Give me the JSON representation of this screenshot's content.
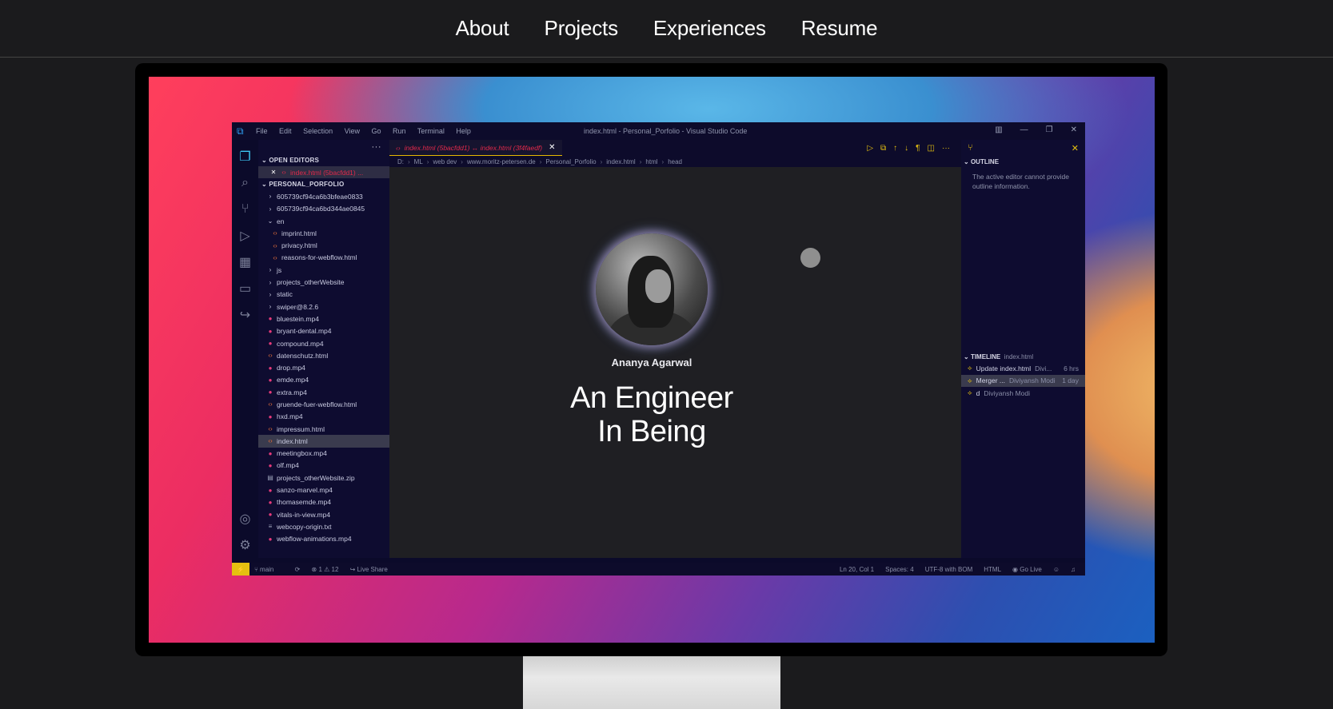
{
  "nav": {
    "items": [
      "About",
      "Projects",
      "Experiences",
      "Resume"
    ]
  },
  "vscode": {
    "window_title": "index.html - Personal_Porfolio - Visual Studio Code",
    "menu": [
      "File",
      "Edit",
      "Selection",
      "View",
      "Go",
      "Run",
      "Terminal",
      "Help"
    ],
    "explorer": {
      "open_editors_label": "OPEN EDITORS",
      "open_editor_file": "index.html (5bacfdd1) ...",
      "project_label": "PERSONAL_PORFOLIO",
      "files": [
        {
          "name": "605739cf94ca6b3bfeae0833",
          "icon": "chevron-right",
          "indent": 0
        },
        {
          "name": "605739cf94ca6bd344ae0845",
          "icon": "chevron-right",
          "indent": 0
        },
        {
          "name": "en",
          "icon": "chevron-down",
          "indent": 0
        },
        {
          "name": "imprint.html",
          "icon": "html",
          "indent": 1
        },
        {
          "name": "privacy.html",
          "icon": "html",
          "indent": 1
        },
        {
          "name": "reasons-for-webflow.html",
          "icon": "html",
          "indent": 1
        },
        {
          "name": "js",
          "icon": "chevron-right",
          "indent": 0
        },
        {
          "name": "projects_otherWebsite",
          "icon": "chevron-right",
          "indent": 0
        },
        {
          "name": "static",
          "icon": "chevron-right",
          "indent": 0
        },
        {
          "name": "swiper@8.2.6",
          "icon": "chevron-right",
          "indent": 0
        },
        {
          "name": "bluestein.mp4",
          "icon": "video",
          "indent": 0
        },
        {
          "name": "bryant-dental.mp4",
          "icon": "video",
          "indent": 0
        },
        {
          "name": "compound.mp4",
          "icon": "video",
          "indent": 0
        },
        {
          "name": "datenschutz.html",
          "icon": "html",
          "indent": 0
        },
        {
          "name": "drop.mp4",
          "icon": "video",
          "indent": 0
        },
        {
          "name": "emde.mp4",
          "icon": "video",
          "indent": 0
        },
        {
          "name": "extra.mp4",
          "icon": "video",
          "indent": 0
        },
        {
          "name": "gruende-fuer-webflow.html",
          "icon": "html",
          "indent": 0
        },
        {
          "name": "hxd.mp4",
          "icon": "video",
          "indent": 0
        },
        {
          "name": "impressum.html",
          "icon": "html",
          "indent": 0
        },
        {
          "name": "index.html",
          "icon": "html",
          "indent": 0,
          "selected": true
        },
        {
          "name": "meetingbox.mp4",
          "icon": "video",
          "indent": 0
        },
        {
          "name": "olf.mp4",
          "icon": "video",
          "indent": 0
        },
        {
          "name": "projects_otherWebsite.zip",
          "icon": "zip",
          "indent": 0
        },
        {
          "name": "sanzo-marvel.mp4",
          "icon": "video",
          "indent": 0
        },
        {
          "name": "thomasemde.mp4",
          "icon": "video",
          "indent": 0
        },
        {
          "name": "vitals-in-view.mp4",
          "icon": "video",
          "indent": 0
        },
        {
          "name": "webcopy-origin.txt",
          "icon": "text",
          "indent": 0
        },
        {
          "name": "webflow-animations.mp4",
          "icon": "video",
          "indent": 0
        }
      ]
    },
    "tab": {
      "label": "index.html (5bacfdd1) ↔ index.html (3f4faedf)"
    },
    "breadcrumb": [
      "D:",
      "ML",
      "web dev",
      "www.moritz-petersen.de",
      "Personal_Porfolio",
      "index.html",
      "html",
      "head"
    ],
    "preview": {
      "name": "Ananya Agarwal",
      "tagline_line1": "An Engineer",
      "tagline_line2": "In Being"
    },
    "outline": {
      "label": "OUTLINE",
      "message": "The active editor cannot provide outline information."
    },
    "timeline": {
      "label": "TIMELINE",
      "file": "index.html",
      "items": [
        {
          "msg": "Update index.html",
          "author": "Divi...",
          "time": "6 hrs"
        },
        {
          "msg": "Merger ...",
          "author": "Diviyansh Modi",
          "time": "1 day"
        },
        {
          "msg": "d",
          "author": "Diviyansh Modi",
          "time": ""
        }
      ]
    },
    "status": {
      "branch": "main",
      "problems": "⊗ 1 ⚠ 12",
      "live_share": "Live Share",
      "position": "Ln 20, Col 1",
      "spaces": "Spaces: 4",
      "encoding": "UTF-8 with BOM",
      "language": "HTML",
      "go_live": "Go Live"
    }
  }
}
